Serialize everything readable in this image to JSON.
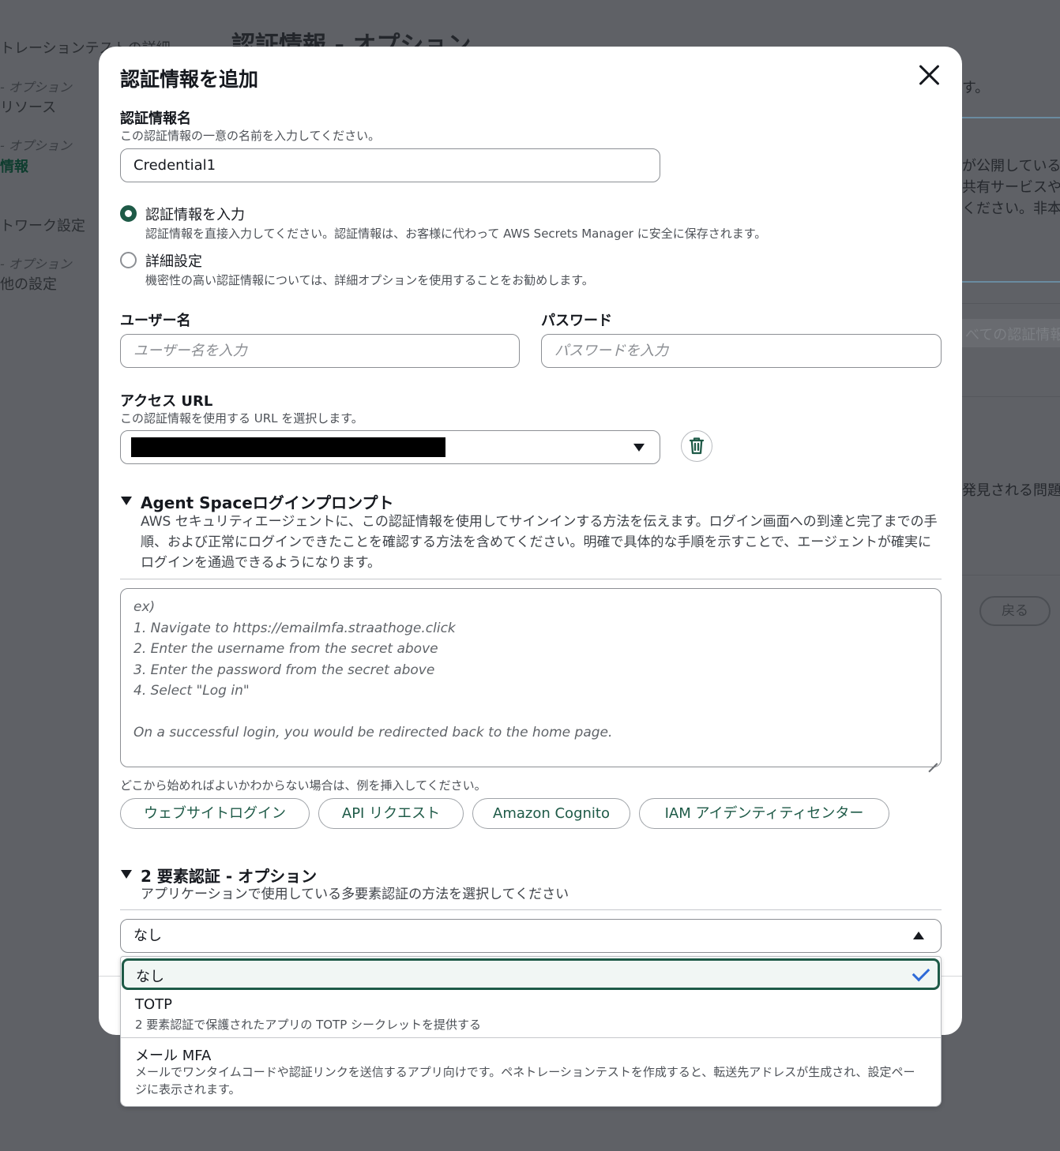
{
  "background": {
    "sidebar": [
      {
        "kind": "step",
        "text": "トレーションテストの詳細"
      },
      {
        "kind": "optional",
        "text": "- オプション"
      },
      {
        "kind": "step",
        "text": "リソース"
      },
      {
        "kind": "optional",
        "text": "- オプション"
      },
      {
        "kind": "active",
        "text": "情報"
      },
      {
        "kind": "step",
        "text": "トワーク設定"
      },
      {
        "kind": "optional",
        "text": "- オプション"
      },
      {
        "kind": "step",
        "text": "他の設定"
      }
    ],
    "page_title": "認証情報 - オプション",
    "right_texts": [
      "す。",
      "が公開している",
      "共有サービスや",
      "ください。非本",
      "べての認証情報",
      "発見される問題"
    ],
    "back_button": "戻る"
  },
  "modal": {
    "title": "認証情報を追加",
    "credential_name": {
      "label": "認証情報名",
      "description": "この認証情報の一意の名前を入力してください。",
      "value": "Credential1"
    },
    "mode": {
      "options": [
        {
          "label": "認証情報を入力",
          "description": "認証情報を直接入力してください。認証情報は、お客様に代わって AWS Secrets Manager に安全に保存されます。",
          "selected": true
        },
        {
          "label": "詳細設定",
          "description": "機密性の高い認証情報については、詳細オプションを使用することをお勧めします。",
          "selected": false
        }
      ]
    },
    "username": {
      "label": "ユーザー名",
      "placeholder": "ユーザー名を入力"
    },
    "password": {
      "label": "パスワード",
      "placeholder": "パスワードを入力"
    },
    "access_url": {
      "label": "アクセス URL",
      "description": "この認証情報を使用する URL を選択します。"
    },
    "login_prompt": {
      "title": "Agent Spaceログインプロンプト",
      "description": "AWS セキュリティエージェントに、この認証情報を使用してサインインする方法を伝えます。ログイン画面への到達と完了までの手順、および正常にログインできたことを確認する方法を含めてください。明確で具体的な手順を示すことで、エージェントが確実にログインを通過できるようになります。",
      "placeholder_lines": [
        "ex)",
        "1. Navigate to https://emailmfa.straathoge.click",
        "2. Enter the username from the secret above",
        "3. Enter the password from the secret above",
        "4. Select \"Log in\"",
        "",
        "On a successful login, you would be redirected back to the home page."
      ],
      "hint": "どこから始めればよいかわからない場合は、例を挿入してください。",
      "examples": [
        "ウェブサイトログイン",
        "API リクエスト",
        "Amazon Cognito",
        "IAM アイデンティティセンター"
      ]
    },
    "mfa": {
      "title": "2 要素認証 - オプション",
      "description": "アプリケーションで使用している多要素認証の方法を選択してください",
      "selected": "なし",
      "options": [
        {
          "label": "なし",
          "description": ""
        },
        {
          "label": "TOTP",
          "description": "2 要素認証で保護されたアプリの TOTP シークレットを提供する"
        },
        {
          "label": "メール MFA",
          "description": "メールでワンタイムコードや認証リンクを送信するアプリ向けです。ペネトレーションテストを作成すると、転送先アドレスが生成され、設定ページに表示されます。"
        }
      ]
    }
  },
  "colors": {
    "accent": "#1e5a47",
    "check": "#2f6bd8",
    "overlay": "#5f6166"
  }
}
